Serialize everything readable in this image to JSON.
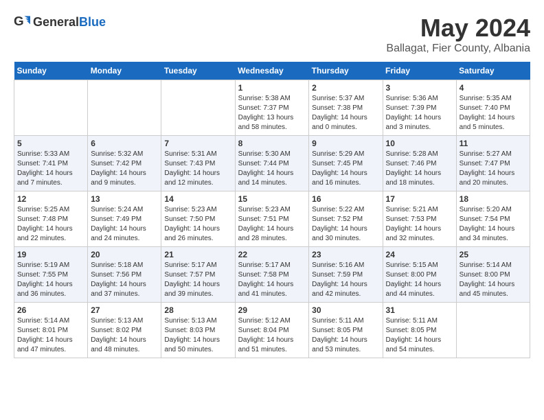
{
  "logo": {
    "general": "General",
    "blue": "Blue"
  },
  "title": {
    "month_year": "May 2024",
    "location": "Ballagat, Fier County, Albania"
  },
  "days_of_week": [
    "Sunday",
    "Monday",
    "Tuesday",
    "Wednesday",
    "Thursday",
    "Friday",
    "Saturday"
  ],
  "weeks": [
    [
      {
        "day": "",
        "info": ""
      },
      {
        "day": "",
        "info": ""
      },
      {
        "day": "",
        "info": ""
      },
      {
        "day": "1",
        "info": "Sunrise: 5:38 AM\nSunset: 7:37 PM\nDaylight: 13 hours and 58 minutes."
      },
      {
        "day": "2",
        "info": "Sunrise: 5:37 AM\nSunset: 7:38 PM\nDaylight: 14 hours and 0 minutes."
      },
      {
        "day": "3",
        "info": "Sunrise: 5:36 AM\nSunset: 7:39 PM\nDaylight: 14 hours and 3 minutes."
      },
      {
        "day": "4",
        "info": "Sunrise: 5:35 AM\nSunset: 7:40 PM\nDaylight: 14 hours and 5 minutes."
      }
    ],
    [
      {
        "day": "5",
        "info": "Sunrise: 5:33 AM\nSunset: 7:41 PM\nDaylight: 14 hours and 7 minutes."
      },
      {
        "day": "6",
        "info": "Sunrise: 5:32 AM\nSunset: 7:42 PM\nDaylight: 14 hours and 9 minutes."
      },
      {
        "day": "7",
        "info": "Sunrise: 5:31 AM\nSunset: 7:43 PM\nDaylight: 14 hours and 12 minutes."
      },
      {
        "day": "8",
        "info": "Sunrise: 5:30 AM\nSunset: 7:44 PM\nDaylight: 14 hours and 14 minutes."
      },
      {
        "day": "9",
        "info": "Sunrise: 5:29 AM\nSunset: 7:45 PM\nDaylight: 14 hours and 16 minutes."
      },
      {
        "day": "10",
        "info": "Sunrise: 5:28 AM\nSunset: 7:46 PM\nDaylight: 14 hours and 18 minutes."
      },
      {
        "day": "11",
        "info": "Sunrise: 5:27 AM\nSunset: 7:47 PM\nDaylight: 14 hours and 20 minutes."
      }
    ],
    [
      {
        "day": "12",
        "info": "Sunrise: 5:25 AM\nSunset: 7:48 PM\nDaylight: 14 hours and 22 minutes."
      },
      {
        "day": "13",
        "info": "Sunrise: 5:24 AM\nSunset: 7:49 PM\nDaylight: 14 hours and 24 minutes."
      },
      {
        "day": "14",
        "info": "Sunrise: 5:23 AM\nSunset: 7:50 PM\nDaylight: 14 hours and 26 minutes."
      },
      {
        "day": "15",
        "info": "Sunrise: 5:23 AM\nSunset: 7:51 PM\nDaylight: 14 hours and 28 minutes."
      },
      {
        "day": "16",
        "info": "Sunrise: 5:22 AM\nSunset: 7:52 PM\nDaylight: 14 hours and 30 minutes."
      },
      {
        "day": "17",
        "info": "Sunrise: 5:21 AM\nSunset: 7:53 PM\nDaylight: 14 hours and 32 minutes."
      },
      {
        "day": "18",
        "info": "Sunrise: 5:20 AM\nSunset: 7:54 PM\nDaylight: 14 hours and 34 minutes."
      }
    ],
    [
      {
        "day": "19",
        "info": "Sunrise: 5:19 AM\nSunset: 7:55 PM\nDaylight: 14 hours and 36 minutes."
      },
      {
        "day": "20",
        "info": "Sunrise: 5:18 AM\nSunset: 7:56 PM\nDaylight: 14 hours and 37 minutes."
      },
      {
        "day": "21",
        "info": "Sunrise: 5:17 AM\nSunset: 7:57 PM\nDaylight: 14 hours and 39 minutes."
      },
      {
        "day": "22",
        "info": "Sunrise: 5:17 AM\nSunset: 7:58 PM\nDaylight: 14 hours and 41 minutes."
      },
      {
        "day": "23",
        "info": "Sunrise: 5:16 AM\nSunset: 7:59 PM\nDaylight: 14 hours and 42 minutes."
      },
      {
        "day": "24",
        "info": "Sunrise: 5:15 AM\nSunset: 8:00 PM\nDaylight: 14 hours and 44 minutes."
      },
      {
        "day": "25",
        "info": "Sunrise: 5:14 AM\nSunset: 8:00 PM\nDaylight: 14 hours and 45 minutes."
      }
    ],
    [
      {
        "day": "26",
        "info": "Sunrise: 5:14 AM\nSunset: 8:01 PM\nDaylight: 14 hours and 47 minutes."
      },
      {
        "day": "27",
        "info": "Sunrise: 5:13 AM\nSunset: 8:02 PM\nDaylight: 14 hours and 48 minutes."
      },
      {
        "day": "28",
        "info": "Sunrise: 5:13 AM\nSunset: 8:03 PM\nDaylight: 14 hours and 50 minutes."
      },
      {
        "day": "29",
        "info": "Sunrise: 5:12 AM\nSunset: 8:04 PM\nDaylight: 14 hours and 51 minutes."
      },
      {
        "day": "30",
        "info": "Sunrise: 5:11 AM\nSunset: 8:05 PM\nDaylight: 14 hours and 53 minutes."
      },
      {
        "day": "31",
        "info": "Sunrise: 5:11 AM\nSunset: 8:05 PM\nDaylight: 14 hours and 54 minutes."
      },
      {
        "day": "",
        "info": ""
      }
    ]
  ]
}
